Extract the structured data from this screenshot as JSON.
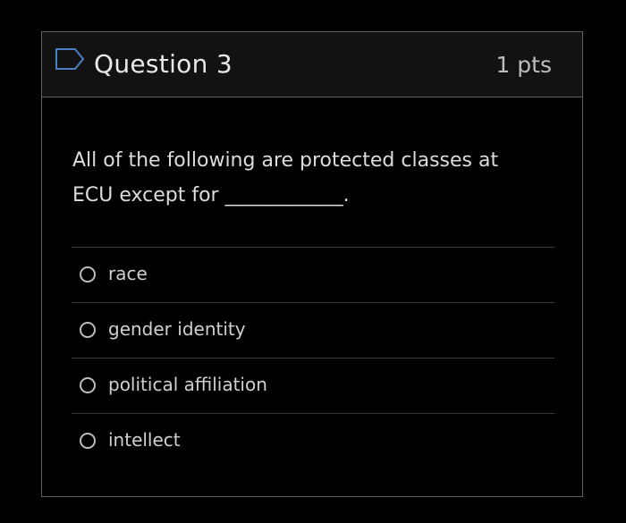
{
  "question": {
    "flag_icon": "flag-outline-icon",
    "title": "Question 3",
    "points": "1 pts",
    "prompt_line1": "All of the following are protected classes at",
    "prompt_line2": "ECU except for ____________.",
    "accent_color": "#4a7fc1"
  },
  "answers": [
    {
      "label": "race",
      "selected": false
    },
    {
      "label": "gender identity",
      "selected": false
    },
    {
      "label": "political affiliation",
      "selected": false
    },
    {
      "label": "intellect",
      "selected": false
    }
  ]
}
